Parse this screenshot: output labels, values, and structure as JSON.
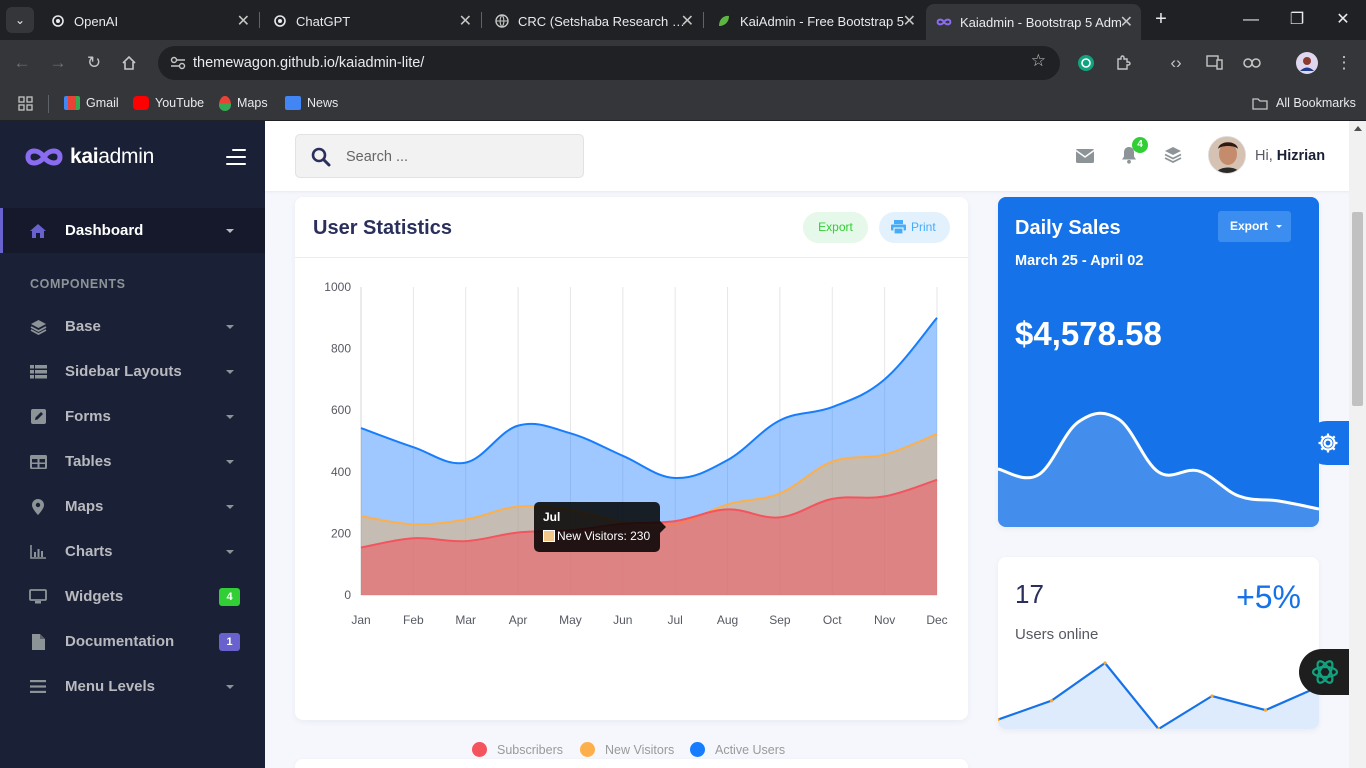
{
  "browser": {
    "tabs": [
      {
        "title": "OpenAI",
        "active": false
      },
      {
        "title": "ChatGPT",
        "active": false
      },
      {
        "title": "CRC (Setshaba Research Cen",
        "active": false
      },
      {
        "title": "KaiAdmin - Free Bootstrap 5",
        "active": false
      },
      {
        "title": "Kaiadmin - Bootstrap 5 Adm",
        "active": true
      }
    ],
    "url": "themewagon.github.io/kaiadmin-lite/",
    "bookmarks": [
      "Gmail",
      "YouTube",
      "Maps",
      "News"
    ],
    "all_bookmarks": "All Bookmarks"
  },
  "app": {
    "logo": {
      "text_kai": "kai",
      "text_admin": "admin"
    },
    "search_placeholder": "Search ...",
    "notification_count": "4",
    "greeting": "Hi,",
    "user_name": "Hizrian",
    "sidebar": {
      "active_item": "Dashboard",
      "section_title": "COMPONENTS",
      "items": [
        {
          "label": "Base",
          "icon": "layers-icon",
          "caret": true
        },
        {
          "label": "Sidebar Layouts",
          "icon": "th-list-icon",
          "caret": true
        },
        {
          "label": "Forms",
          "icon": "pen-square-icon",
          "caret": true
        },
        {
          "label": "Tables",
          "icon": "table-icon",
          "caret": true
        },
        {
          "label": "Maps",
          "icon": "map-marker-icon",
          "caret": true
        },
        {
          "label": "Charts",
          "icon": "chart-bar-icon",
          "caret": true
        },
        {
          "label": "Widgets",
          "icon": "desktop-icon",
          "badge": "4",
          "badge_color": "#31ce36"
        },
        {
          "label": "Documentation",
          "icon": "file-icon",
          "badge": "1",
          "badge_color": "#6861ce"
        },
        {
          "label": "Menu Levels",
          "icon": "bars-icon",
          "caret": true
        }
      ]
    },
    "user_statistics": {
      "title": "User Statistics",
      "export_label": "Export",
      "print_label": "Print",
      "tooltip": {
        "title": "Jul",
        "body": "New Visitors: 230"
      }
    },
    "daily_sales": {
      "title": "Daily Sales",
      "export_label": "Export",
      "date_range": "March 25 - April 02",
      "amount": "$4,578.58"
    },
    "users_online": {
      "count": "17",
      "change": "+5%",
      "label": "Users online"
    },
    "colors": {
      "primary": "#1572e8",
      "sidebar_bg": "#1a2035",
      "subscribers": "#f3545d",
      "new_visitors": "#fdaf4b",
      "active_users": "#177dff"
    }
  },
  "chart_data": [
    {
      "type": "area",
      "title": "User Statistics",
      "categories": [
        "Jan",
        "Feb",
        "Mar",
        "Apr",
        "May",
        "Jun",
        "Jul",
        "Aug",
        "Sep",
        "Oct",
        "Nov",
        "Dec"
      ],
      "ylim": [
        0,
        1000
      ],
      "yticks": [
        0,
        200,
        400,
        600,
        800,
        1000
      ],
      "grid": "vertical",
      "legend": "bottom",
      "series": [
        {
          "name": "Subscribers",
          "color": "#f3545d",
          "values": [
            154,
            184,
            175,
            203,
            210,
            231,
            240,
            278,
            252,
            312,
            320,
            374
          ]
        },
        {
          "name": "New Visitors",
          "color": "#fdaf4b",
          "values": [
            256,
            230,
            245,
            287,
            276,
            236,
            230,
            294,
            330,
            433,
            456,
            523
          ]
        },
        {
          "name": "Active Users",
          "color": "#177dff",
          "values": [
            542,
            480,
            430,
            550,
            525,
            452,
            380,
            438,
            567,
            610,
            700,
            900
          ]
        }
      ]
    },
    {
      "type": "area",
      "title": "Daily Sales",
      "values": [
        68,
        62,
        115,
        118,
        65,
        66,
        41,
        36,
        28
      ]
    },
    {
      "type": "line",
      "title": "Users online",
      "values": [
        10,
        30,
        70,
        0,
        35,
        20,
        45
      ]
    }
  ]
}
